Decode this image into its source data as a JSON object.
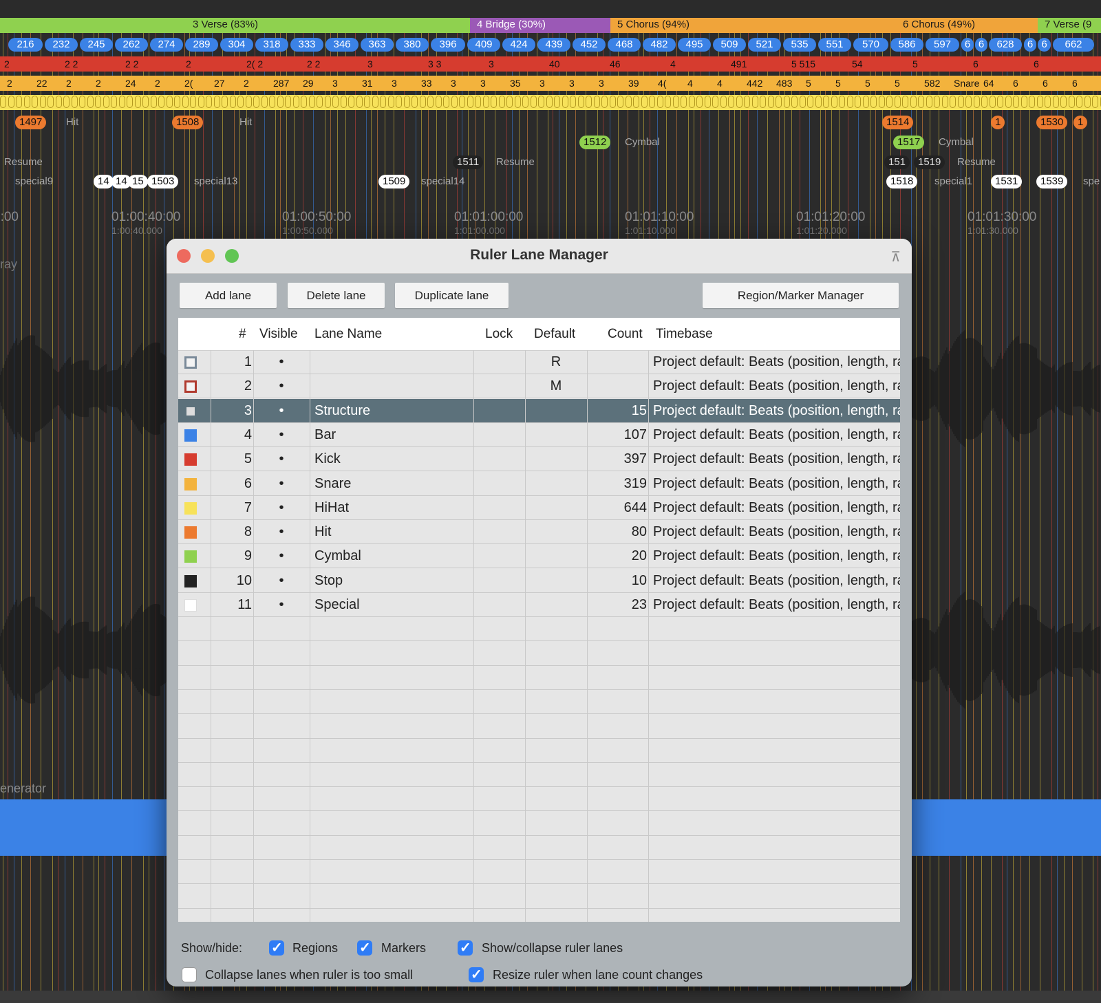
{
  "ruler": {
    "structure_segments": [
      {
        "label": "3  Verse (83%)",
        "color": "#8fd14f"
      },
      {
        "label": "4  Bridge (30%)",
        "color": "#9b59b6"
      },
      {
        "label": "5  Chorus (94%)",
        "color": "#f0a43a"
      },
      {
        "label": "6  Chorus (49%)",
        "color": "#f0a43a"
      },
      {
        "label": "7  Verse (9",
        "color": "#8fd14f"
      }
    ],
    "bar_numbers": [
      "216",
      "232",
      "245",
      "262",
      "274",
      "289",
      "304",
      "318",
      "333",
      "346",
      "363",
      "380",
      "396",
      "409",
      "424",
      "439",
      "452",
      "468",
      "482",
      "495",
      "509",
      "521",
      "535",
      "551",
      "570",
      "586",
      "597",
      "6",
      "6",
      "628",
      "6",
      "6",
      "662"
    ],
    "kick_labels": [
      "2",
      "2 2",
      "2 2",
      "2",
      "2( 2",
      "2 2",
      "3",
      "3 3",
      "3",
      "40",
      "46",
      "4",
      "491",
      "5 515",
      "54",
      "5",
      "6",
      "6"
    ],
    "snare_labels": [
      "2",
      "22",
      "2",
      "2",
      "24",
      "2",
      "2(",
      "27",
      "2",
      "287",
      "29",
      "3",
      "31",
      "3",
      "33",
      "3",
      "3",
      "35",
      "3",
      "3",
      "3",
      "39",
      "4(",
      "4",
      "4",
      "442",
      "483",
      "5",
      "5",
      "5",
      "5",
      "582",
      "Snare",
      "64",
      "6",
      "6",
      "6"
    ],
    "hit_labels": [
      "1497",
      "Hit",
      "1508",
      "Hit",
      "1514",
      "1",
      "1530",
      "1"
    ],
    "cymbal_labels": [
      "1512",
      "Cymbal",
      "1517",
      "Cymbal"
    ],
    "stop_labels": [
      "Resume",
      "1511",
      "Resume",
      "151",
      "1519",
      "Resume"
    ],
    "special_labels": [
      "special9",
      "14",
      "14",
      "15",
      "1503",
      "special13",
      "1509",
      "special14",
      "1518",
      "special1",
      "1531",
      "1539",
      "spe"
    ],
    "timecodes": [
      {
        "main": "0:00",
        "sub": ""
      },
      {
        "main": "01:00:40:00",
        "sub": "1:00:40.000"
      },
      {
        "main": "01:00:50:00",
        "sub": "1:00:50.000"
      },
      {
        "main": "01:01:00:00",
        "sub": "1:01:00.000"
      },
      {
        "main": "01:01:10:00",
        "sub": "1:01:10.000"
      },
      {
        "main": "01:01:20:00",
        "sub": "1:01:20.000"
      },
      {
        "main": "01:01:30:00",
        "sub": "1:01:30.000"
      }
    ],
    "track_names": [
      "ray",
      "enerator"
    ]
  },
  "dialog": {
    "title": "Ruler Lane Manager",
    "buttons": {
      "add": "Add lane",
      "delete": "Delete lane",
      "duplicate": "Duplicate lane",
      "region_marker": "Region/Marker Manager"
    },
    "columns": [
      "#",
      "Visible",
      "Lane Name",
      "Lock",
      "Default",
      "Count",
      "Timebase"
    ],
    "selected_row": 3,
    "rows": [
      {
        "num": "1",
        "visible": "•",
        "name": "",
        "lock": "",
        "default": "R",
        "count": "",
        "timebase": "Project default: Beats (position, length, rate)",
        "swatch": "#7a8a99",
        "swatch_style": "outline"
      },
      {
        "num": "2",
        "visible": "•",
        "name": "",
        "lock": "",
        "default": "M",
        "count": "",
        "timebase": "Project default: Beats (position, length, rate)",
        "swatch": "#b03a2e",
        "swatch_style": "outline"
      },
      {
        "num": "3",
        "visible": "•",
        "name": "Structure",
        "lock": "",
        "default": "",
        "count": "15",
        "timebase": "Project default: Beats (position, length, rate)",
        "swatch": "#dddddd",
        "swatch_style": "small"
      },
      {
        "num": "4",
        "visible": "•",
        "name": "Bar",
        "lock": "",
        "default": "",
        "count": "107",
        "timebase": "Project default: Beats (position, length, rate)",
        "swatch": "#3b82e6",
        "swatch_style": "fill"
      },
      {
        "num": "5",
        "visible": "•",
        "name": "Kick",
        "lock": "",
        "default": "",
        "count": "397",
        "timebase": "Project default: Beats (position, length, rate)",
        "swatch": "#d63c2f",
        "swatch_style": "fill"
      },
      {
        "num": "6",
        "visible": "•",
        "name": "Snare",
        "lock": "",
        "default": "",
        "count": "319",
        "timebase": "Project default: Beats (position, length, rate)",
        "swatch": "#f3b33d",
        "swatch_style": "fill"
      },
      {
        "num": "7",
        "visible": "•",
        "name": "HiHat",
        "lock": "",
        "default": "",
        "count": "644",
        "timebase": "Project default: Beats (position, length, rate)",
        "swatch": "#f7e25a",
        "swatch_style": "fill"
      },
      {
        "num": "8",
        "visible": "•",
        "name": "Hit",
        "lock": "",
        "default": "",
        "count": "80",
        "timebase": "Project default: Beats (position, length, rate)",
        "swatch": "#ec7a2f",
        "swatch_style": "fill"
      },
      {
        "num": "9",
        "visible": "•",
        "name": "Cymbal",
        "lock": "",
        "default": "",
        "count": "20",
        "timebase": "Project default: Beats (position, length, rate)",
        "swatch": "#8fd14f",
        "swatch_style": "fill"
      },
      {
        "num": "10",
        "visible": "•",
        "name": "Stop",
        "lock": "",
        "default": "",
        "count": "10",
        "timebase": "Project default: Beats (position, length, rate)",
        "swatch": "#222222",
        "swatch_style": "fill"
      },
      {
        "num": "11",
        "visible": "•",
        "name": "Special",
        "lock": "",
        "default": "",
        "count": "23",
        "timebase": "Project default: Beats (position, length, rate)",
        "swatch": "#ffffff",
        "swatch_style": "fill"
      }
    ],
    "footer": {
      "show_hide_label": "Show/hide:",
      "regions": {
        "label": "Regions",
        "checked": true
      },
      "markers": {
        "label": "Markers",
        "checked": true
      },
      "show_collapse": {
        "label": "Show/collapse ruler lanes",
        "checked": true
      },
      "collapse_small": {
        "label": "Collapse lanes when ruler is too small",
        "checked": false
      },
      "resize_ruler": {
        "label": "Resize ruler when lane count changes",
        "checked": true
      }
    }
  }
}
